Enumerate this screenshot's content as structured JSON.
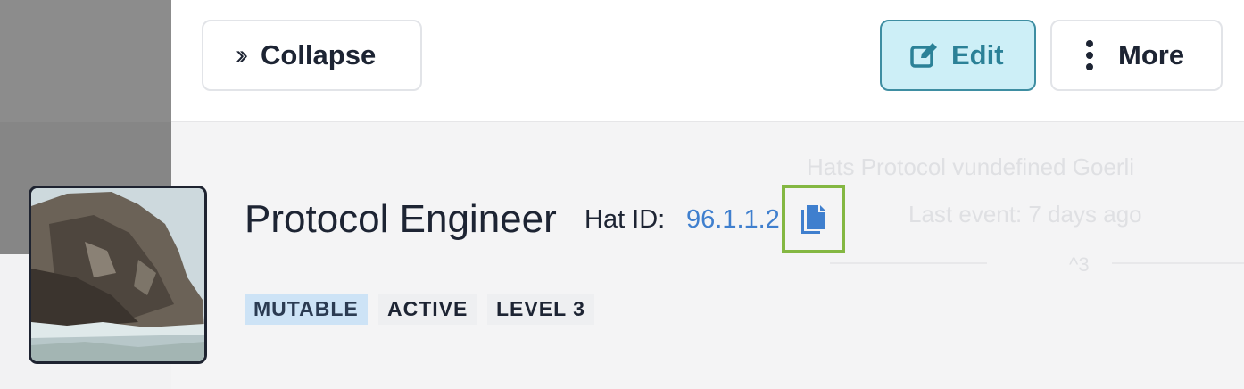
{
  "toolbar": {
    "collapse_label": "Collapse",
    "edit_label": "Edit",
    "more_label": "More"
  },
  "hat": {
    "name": "Protocol Engineer",
    "id_label": "Hat ID:",
    "id_value": "96.1.1.2",
    "badges": [
      "MUTABLE",
      "ACTIVE",
      "LEVEL 3"
    ]
  },
  "background": {
    "tree_label": "Hats Protocol vundefined Goerli",
    "last_event": "Last event: 7 days ago",
    "count": "^3"
  },
  "icons": {
    "collapse": "double-chevron-right-icon",
    "edit": "edit-icon",
    "more": "vertical-dots-icon",
    "copy": "copy-icon"
  },
  "colors": {
    "accent": "#2b8197",
    "edit_bg": "#cdeff7",
    "link": "#3f7fce",
    "highlight": "#84b742",
    "mutable_badge": "#cde3f6"
  }
}
